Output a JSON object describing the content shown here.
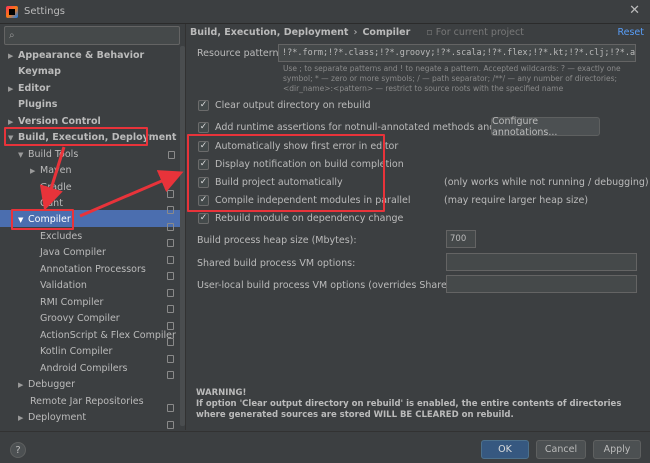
{
  "window": {
    "title": "Settings"
  },
  "sidebar": {
    "items": [
      {
        "label": "Appearance & Behavior",
        "arrow": "▶",
        "bold": true
      },
      {
        "label": "Keymap",
        "arrow": "",
        "bold": true
      },
      {
        "label": "Editor",
        "arrow": "▶",
        "bold": true
      },
      {
        "label": "Plugins",
        "arrow": "",
        "bold": true
      },
      {
        "label": "Version Control",
        "arrow": "▶",
        "bold": true
      },
      {
        "label": "Build, Execution, Deployment",
        "arrow": "▼",
        "bold": true
      },
      {
        "label": "Build Tools",
        "arrow": "▼",
        "bold": false
      },
      {
        "label": "Maven",
        "arrow": "▶",
        "bold": false
      },
      {
        "label": "Gradle",
        "arrow": "",
        "bold": false
      },
      {
        "label": "Gant",
        "arrow": "",
        "bold": false
      },
      {
        "label": "Compiler",
        "arrow": "▼",
        "bold": false
      },
      {
        "label": "Excludes",
        "arrow": "",
        "bold": false
      },
      {
        "label": "Java Compiler",
        "arrow": "",
        "bold": false
      },
      {
        "label": "Annotation Processors",
        "arrow": "",
        "bold": false
      },
      {
        "label": "Validation",
        "arrow": "",
        "bold": false
      },
      {
        "label": "RMI Compiler",
        "arrow": "",
        "bold": false
      },
      {
        "label": "Groovy Compiler",
        "arrow": "",
        "bold": false
      },
      {
        "label": "ActionScript & Flex Compiler",
        "arrow": "",
        "bold": false
      },
      {
        "label": "Kotlin Compiler",
        "arrow": "",
        "bold": false
      },
      {
        "label": "Android Compilers",
        "arrow": "",
        "bold": false
      },
      {
        "label": "Debugger",
        "arrow": "▶",
        "bold": false
      },
      {
        "label": "Remote Jar Repositories",
        "arrow": "",
        "bold": false
      },
      {
        "label": "Deployment",
        "arrow": "▶",
        "bold": false
      }
    ],
    "selected": "Compiler"
  },
  "header": {
    "breadcrumb_parent": "Build, Execution, Deployment",
    "breadcrumb_sep": "›",
    "breadcrumb_current": "Compiler",
    "scope_note": "For current project",
    "reset_label": "Reset"
  },
  "resource": {
    "label": "Resource patterns:",
    "value": "!?*.form;!?*.class;!?*.groovy;!?*.scala;!?*.flex;!?*.kt;!?*.clj;!?*.aj",
    "hint": "Use ; to separate patterns and ! to negate a pattern. Accepted wildcards: ? — exactly one symbol; * — zero or more symbols; / — path separator; /**/ — any number of directories; <dir_name>:<pattern> — restrict to source roots with the specified name"
  },
  "options": [
    {
      "label": "Clear output directory on rebuild",
      "checked": true
    },
    {
      "label": "Add runtime assertions for notnull-annotated methods and parameters",
      "checked": true
    },
    {
      "label": "Automatically show first error in editor",
      "checked": true
    },
    {
      "label": "Display notification on build completion",
      "checked": true
    },
    {
      "label": "Build project automatically",
      "checked": true
    },
    {
      "label": "Compile independent modules in parallel",
      "checked": true
    },
    {
      "label": "Rebuild module on dependency change",
      "checked": true
    }
  ],
  "notes": {
    "build_auto": "(only works while not running / debugging)",
    "parallel": "(may require larger heap size)"
  },
  "configure_button": "Configure annotations...",
  "heap": {
    "label": "Build process heap size (Mbytes):",
    "value": "700"
  },
  "shared_vm": {
    "label": "Shared build process VM options:",
    "value": ""
  },
  "user_vm": {
    "label": "User-local build process VM options (overrides Shared options):",
    "value": ""
  },
  "warning": {
    "title": "WARNING!",
    "text": "If option 'Clear output directory on rebuild' is enabled, the entire contents of directories where generated sources are stored WILL BE CLEARED on rebuild."
  },
  "footer": {
    "help": "?",
    "ok": "OK",
    "cancel": "Cancel",
    "apply": "Apply"
  },
  "colors": {
    "background": "#3c3f41",
    "selection": "#4b6eaf",
    "highlight": "#e8333a",
    "link": "#589df6",
    "primary": "#365880"
  }
}
